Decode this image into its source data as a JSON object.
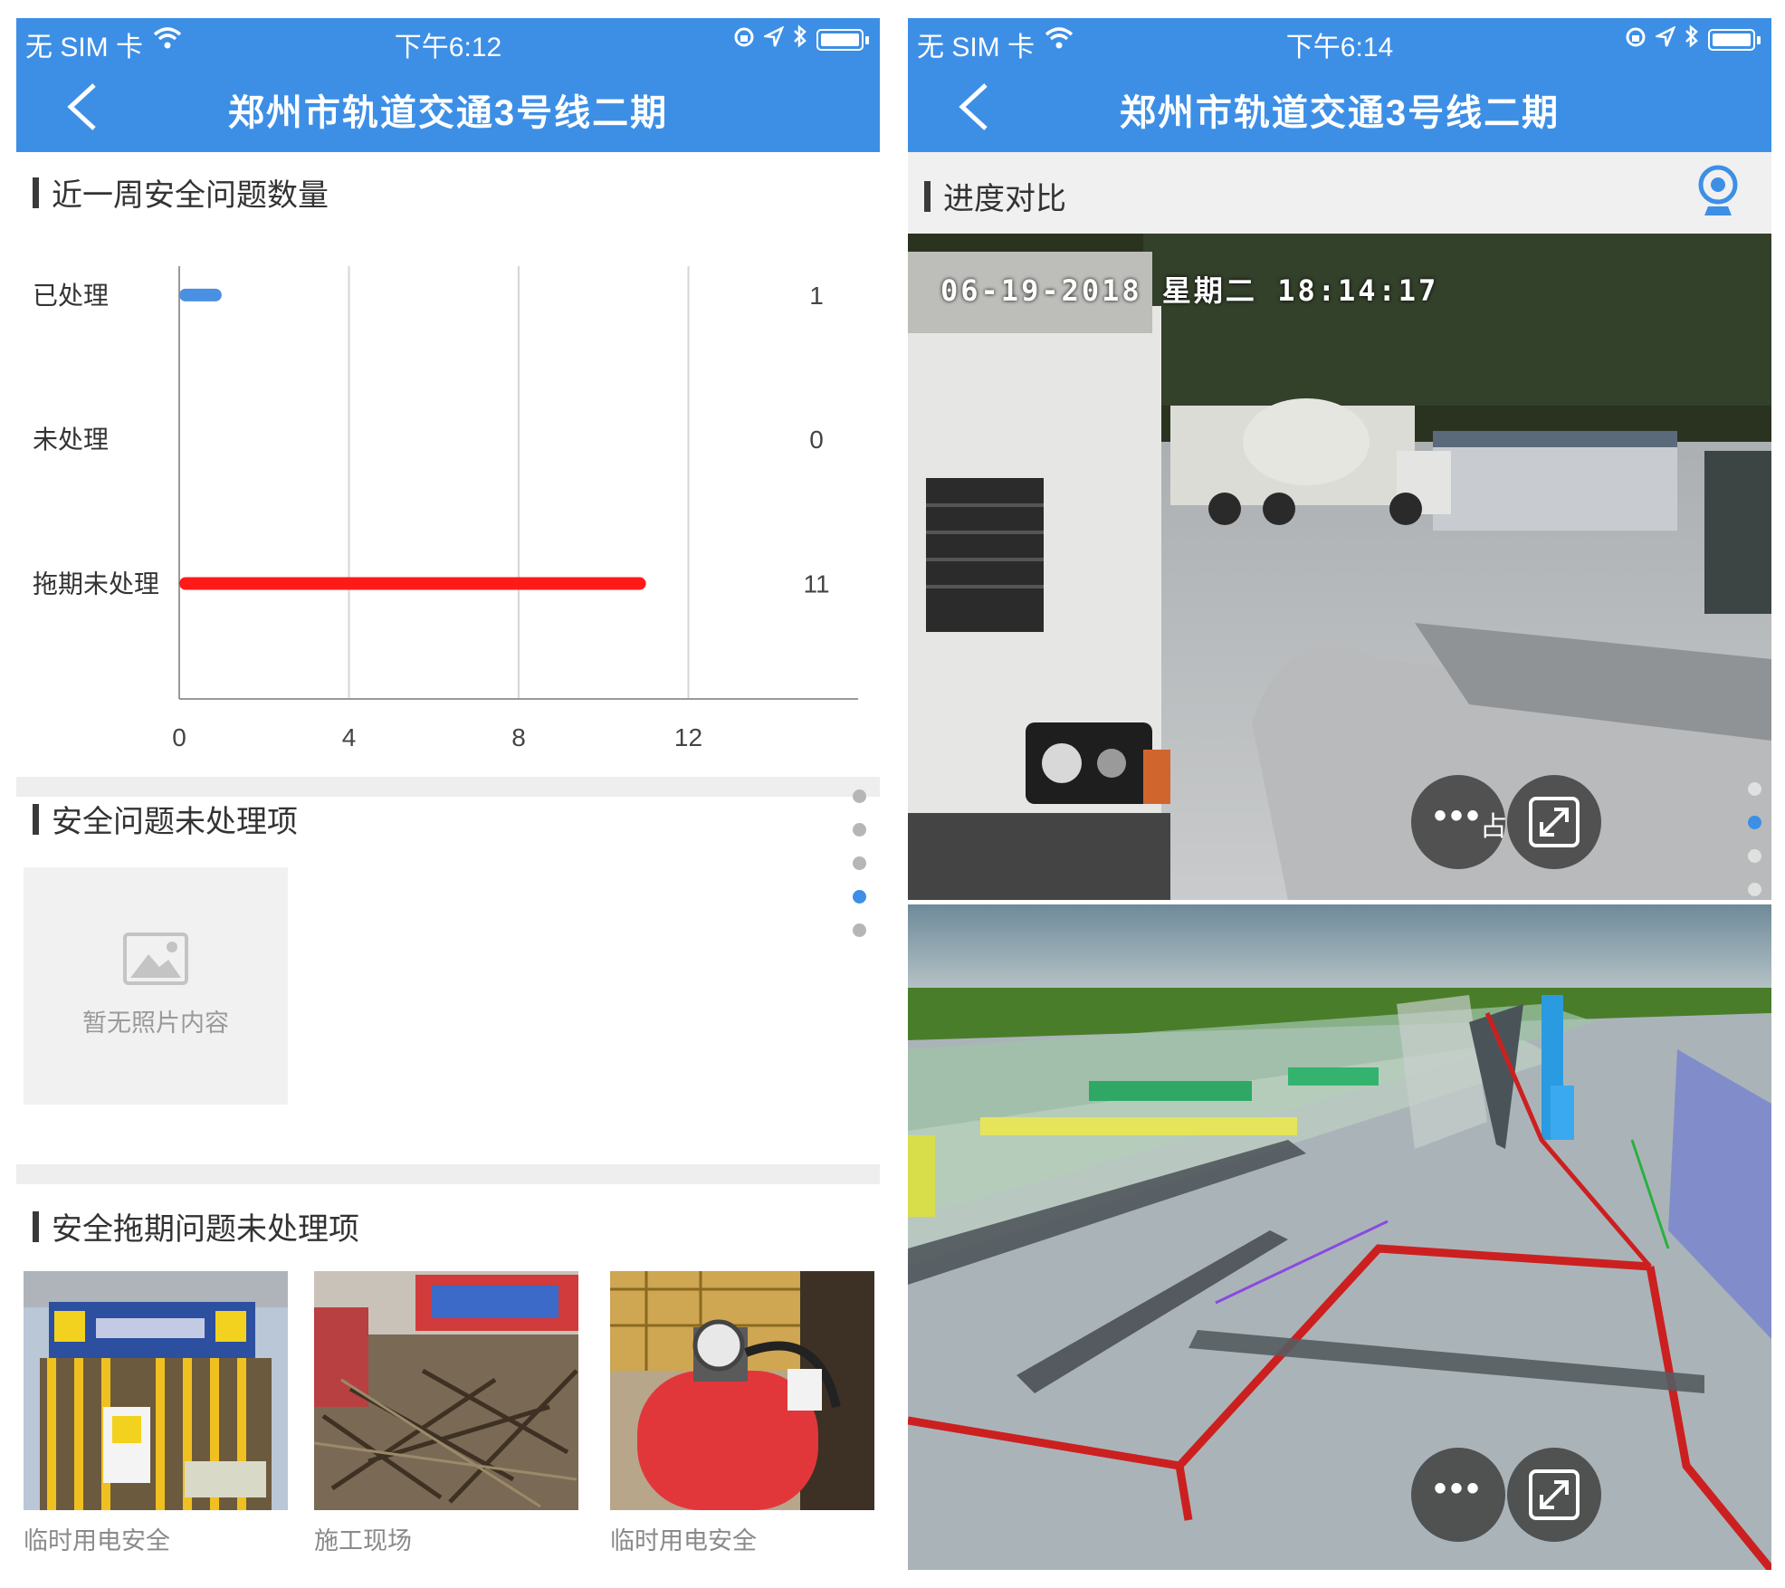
{
  "left": {
    "status": {
      "carrier": "无 SIM 卡",
      "time": "下午6:12"
    },
    "nav": {
      "title": "郑州市轨道交通3号线二期"
    },
    "chart_section": {
      "title": "近一周安全问题数量"
    },
    "chart_data": {
      "type": "bar",
      "orientation": "horizontal",
      "categories": [
        "已处理",
        "未处理",
        "拖期未处理"
      ],
      "values": [
        1,
        0,
        11
      ],
      "value_labels": [
        "1",
        "0",
        "11"
      ],
      "xticks": [
        "0",
        "4",
        "8",
        "12"
      ],
      "xlim": [
        0,
        16
      ],
      "grid": true,
      "colors": [
        "#4a90e2",
        "#4a90e2",
        "#ff1a1a"
      ]
    },
    "unprocessed_section": {
      "title": "安全问题未处理项",
      "empty_text": "暂无照片内容"
    },
    "overdue_section": {
      "title": "安全拖期问题未处理项",
      "items": [
        {
          "caption": "临时用电安全"
        },
        {
          "caption": "施工现场"
        },
        {
          "caption": "临时用电安全"
        }
      ]
    }
  },
  "right": {
    "status": {
      "carrier": "无 SIM 卡",
      "time": "下午6:14"
    },
    "nav": {
      "title": "郑州市轨道交通3号线二期"
    },
    "progress_section": {
      "title": "进度对比"
    },
    "camera_osd": "06-19-2018 星期二 18:14:17",
    "overlay_glyph": "占"
  },
  "colors": {
    "nav_blue": "#3d8fe6",
    "overdue_red": "#ff1a1a",
    "processed_blue": "#4a90e2"
  }
}
